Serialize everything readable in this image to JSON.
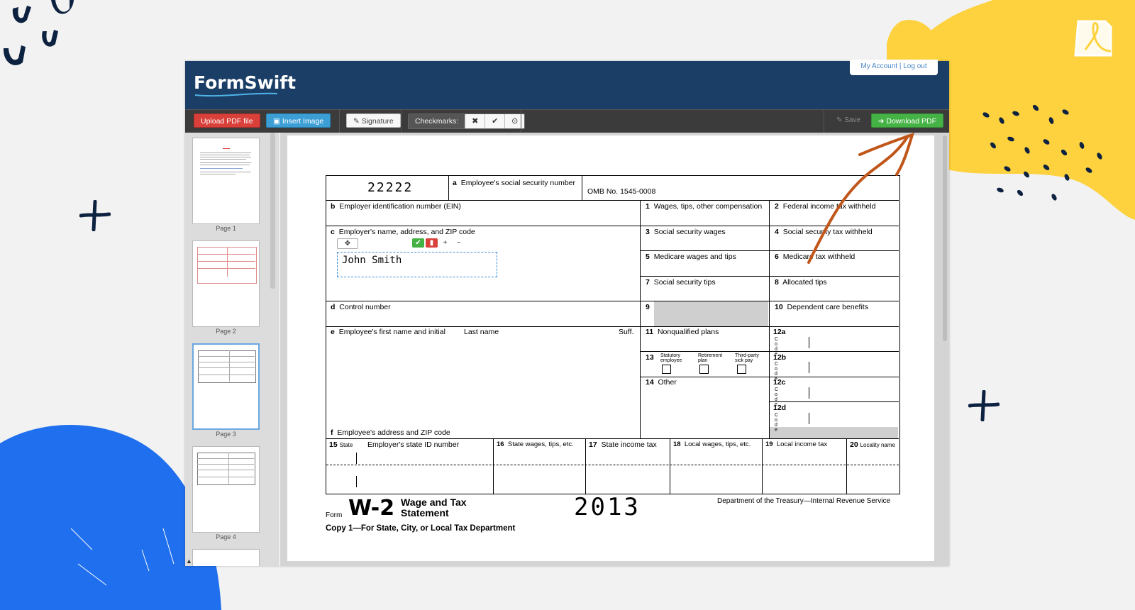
{
  "account": {
    "my_account": "My Account",
    "sep": "|",
    "logout": "Log out"
  },
  "logo": {
    "part1": "Form",
    "part2": "Swift"
  },
  "toolbar": {
    "upload_label": "Upload PDF file",
    "insert_image_label": "Insert Image",
    "signature_label": "Signature",
    "checkmarks_label": "Checkmarks:",
    "check_x": "✖",
    "check_tick": "✔",
    "check_circle": "⊙",
    "save_label": "Save",
    "download_label": "Download PDF"
  },
  "sidebar": {
    "pages": [
      {
        "label": "Page 1"
      },
      {
        "label": "Page 2"
      },
      {
        "label": "Page 3"
      },
      {
        "label": "Page 4"
      }
    ]
  },
  "form": {
    "control_code": "22222",
    "a_label": "Employee's social security number",
    "omb": "OMB No. 1545-0008",
    "b_label": "Employer identification number (EIN)",
    "c_label": "Employer's name, address, and ZIP code",
    "d_label": "Control number",
    "e_label": "Employee's first name and initial",
    "e_last": "Last name",
    "e_suff": "Suff.",
    "f_label": "Employee's address and ZIP code",
    "box1": "Wages, tips, other compensation",
    "box2": "Federal income tax withheld",
    "box3": "Social security wages",
    "box4": "Social security tax withheld",
    "box5": "Medicare wages and tips",
    "box6": "Medicare tax withheld",
    "box7": "Social security tips",
    "box8": "Allocated tips",
    "box9": "9",
    "box10": "Dependent care benefits",
    "box11": "Nonqualified plans",
    "box12a": "12a",
    "box12b": "12b",
    "box12c": "12c",
    "box12d": "12d",
    "code_letters": "C o d e",
    "box13": "13",
    "statutory": "Statutory employee",
    "retirement": "Retirement plan",
    "thirdparty": "Third-party sick pay",
    "box14": "Other",
    "box15": "State",
    "box15b": "Employer's state ID number",
    "box16": "State wages, tips, etc.",
    "box17": "State income tax",
    "box18": "Local wages, tips, etc.",
    "box19": "Local income tax",
    "box20": "Locality name",
    "employer_name_value": "John Smith",
    "form_word": "Form",
    "w2": "W-2",
    "w2_title": "Wage and Tax Statement",
    "year": "2013",
    "dept": "Department of the Treasury—Internal Revenue Service",
    "copy": "Copy 1—For State, City, or Local Tax Department"
  }
}
